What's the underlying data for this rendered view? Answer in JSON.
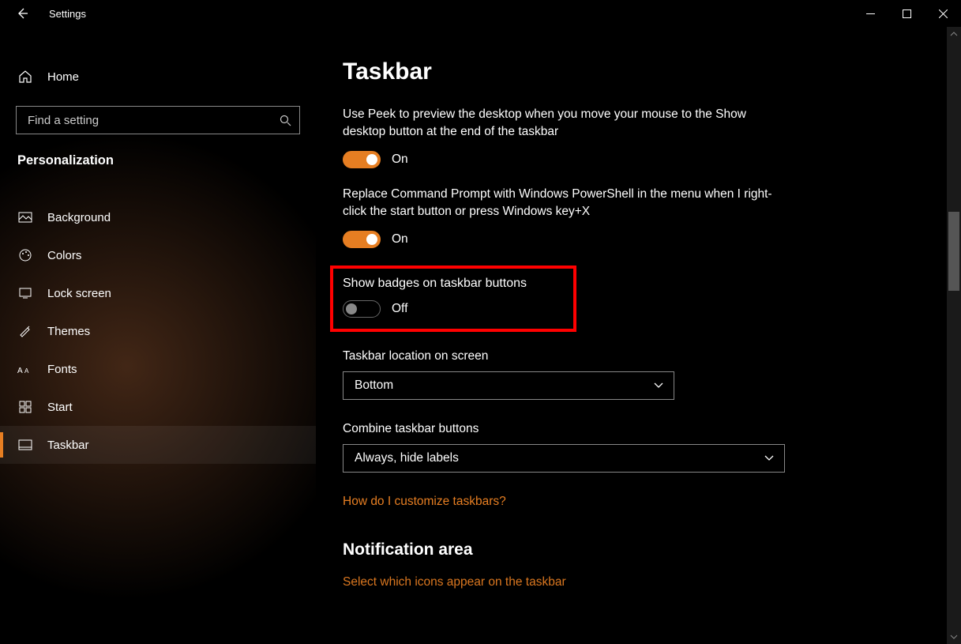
{
  "titlebar": {
    "title": "Settings"
  },
  "sidebar": {
    "home_label": "Home",
    "search_placeholder": "Find a setting",
    "category": "Personalization",
    "items": [
      {
        "label": "Background"
      },
      {
        "label": "Colors"
      },
      {
        "label": "Lock screen"
      },
      {
        "label": "Themes"
      },
      {
        "label": "Fonts"
      },
      {
        "label": "Start"
      },
      {
        "label": "Taskbar"
      }
    ]
  },
  "content": {
    "heading": "Taskbar",
    "peek": {
      "desc": "Use Peek to preview the desktop when you move your mouse to the Show desktop button at the end of the taskbar",
      "state": "On"
    },
    "powershell": {
      "desc": "Replace Command Prompt with Windows PowerShell in the menu when I right-click the start button or press Windows key+X",
      "state": "On"
    },
    "badges": {
      "desc": "Show badges on taskbar buttons",
      "state": "Off"
    },
    "location": {
      "label": "Taskbar location on screen",
      "value": "Bottom"
    },
    "combine": {
      "label": "Combine taskbar buttons",
      "value": "Always, hide labels"
    },
    "help_link": "How do I customize taskbars?",
    "notification_heading": "Notification area",
    "notification_link": "Select which icons appear on the taskbar"
  },
  "colors": {
    "accent": "#e67e22",
    "highlight": "#ff0000"
  }
}
